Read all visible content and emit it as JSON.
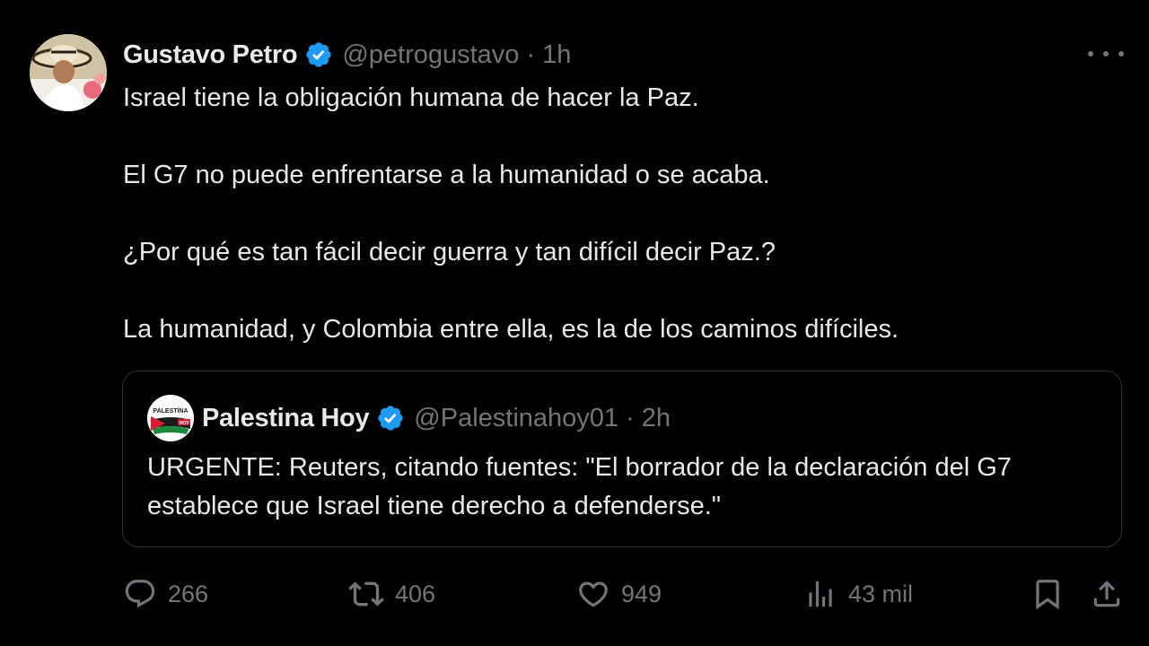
{
  "tweet": {
    "author_name": "Gustavo Petro",
    "handle": "@petrogustavo",
    "separator": "·",
    "time": "1h",
    "paragraphs": [
      "Israel tiene la obligación humana de hacer la Paz.",
      "El G7 no puede enfrentarse a la humanidad o se acaba.",
      "¿Por qué es tan fácil decir guerra y tan difícil decir Paz.?",
      "La humanidad, y Colombia entre ella, es la de los caminos difíciles."
    ]
  },
  "quoted": {
    "author_name": "Palestina Hoy",
    "handle": "@Palestinahoy01",
    "separator": "·",
    "time": "2h",
    "text": "URGENTE: Reuters, citando fuentes: \"El borrador de la declaración del G7 establece que Israel tiene derecho a defenderse.\"",
    "avatar_text": "PALESTINA HOY"
  },
  "actions": {
    "replies": "266",
    "reposts": "406",
    "likes": "949",
    "views": "43 mil"
  },
  "colors": {
    "background": "#000000",
    "text_primary": "#e7e9ea",
    "text_secondary": "#71767b",
    "verified_blue": "#1d9bf0",
    "border": "#2f3336"
  }
}
